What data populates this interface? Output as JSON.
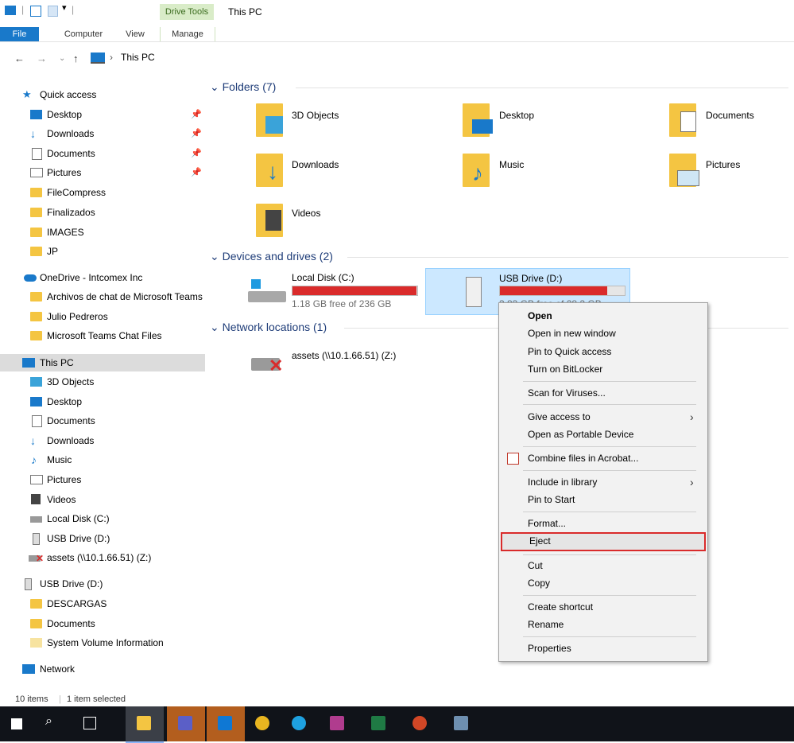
{
  "ribbon": {
    "context_tab_header": "Drive Tools",
    "window_title": "This PC",
    "tabs": [
      "File",
      "Computer",
      "View",
      "Manage"
    ]
  },
  "address": {
    "path": "This PC",
    "icons": [
      "back-arrow-icon",
      "forward-arrow-icon",
      "dropdown-icon",
      "up-arrow-icon"
    ]
  },
  "sidebar": {
    "quick_access": "Quick access",
    "quick_items": [
      "Desktop",
      "Downloads",
      "Documents",
      "Pictures",
      "FileCompress",
      "Finalizados",
      "IMAGES",
      "JP"
    ],
    "onedrive": "OneDrive - Intcomex Inc",
    "onedrive_items": [
      "Archivos de chat de Microsoft Teams",
      "Julio Pedreros",
      "Microsoft Teams Chat Files"
    ],
    "this_pc": "This PC",
    "this_pc_items": [
      "3D Objects",
      "Desktop",
      "Documents",
      "Downloads",
      "Music",
      "Pictures",
      "Videos",
      "Local Disk (C:)",
      "USB Drive (D:)",
      "assets (\\\\10.1.66.51) (Z:)"
    ],
    "usb": "USB Drive (D:)",
    "usb_items": [
      "DESCARGAS",
      "Documents",
      "System Volume Information"
    ],
    "network": "Network"
  },
  "main": {
    "folders_header": "Folders (7)",
    "folders": [
      "3D Objects",
      "Desktop",
      "Documents",
      "Downloads",
      "Music",
      "Pictures",
      "Videos"
    ],
    "devices_header": "Devices and drives (2)",
    "local_disk": {
      "name": "Local Disk (C:)",
      "free": "1.18 GB free of 236 GB",
      "used_fraction": 0.995
    },
    "usb_drive": {
      "name": "USB Drive (D:)",
      "free": "3.83 GB free of 28.2 GB",
      "used_fraction": 0.86
    },
    "network_header": "Network locations (1)",
    "network_drive": "assets (\\\\10.1.66.51) (Z:)"
  },
  "context_menu": {
    "items": [
      "Open",
      "Open in new window",
      "Pin to Quick access",
      "Turn on BitLocker",
      "Scan for Viruses...",
      "Give access to",
      "Open as Portable Device",
      "Combine files in Acrobat...",
      "Include in library",
      "Pin to Start",
      "Format...",
      "Eject",
      "Cut",
      "Copy",
      "Create shortcut",
      "Rename",
      "Properties"
    ]
  },
  "status": {
    "items": "10 items",
    "selected": "1 item selected"
  },
  "colors": {
    "accent": "#1979ca",
    "bar_red": "#da2b2b",
    "highlight": "#cce8ff",
    "context_green": "#d9ecc8",
    "taskbar": "#101319"
  }
}
